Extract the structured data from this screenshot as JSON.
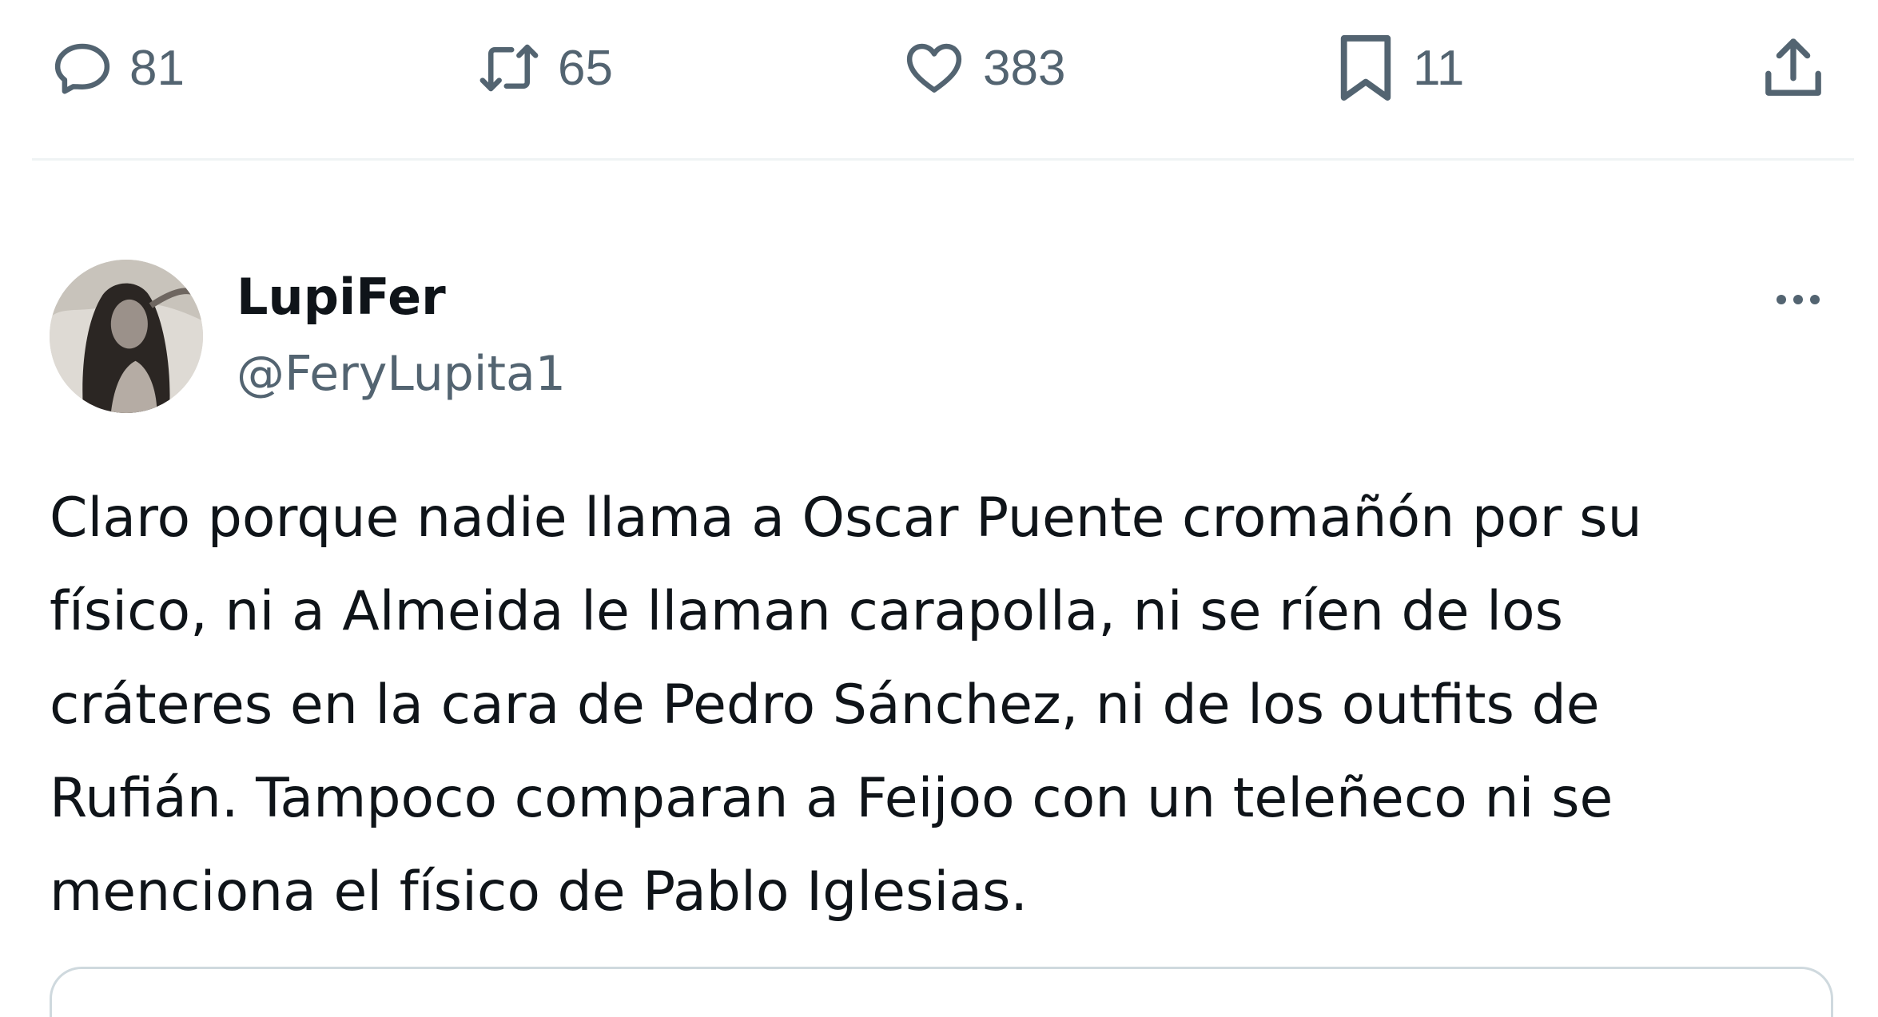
{
  "actions": {
    "reply": {
      "icon": "reply-icon",
      "count": "81"
    },
    "retweet": {
      "icon": "retweet-icon",
      "count": "65"
    },
    "like": {
      "icon": "heart-icon",
      "count": "383"
    },
    "bookmark": {
      "icon": "bookmark-icon",
      "count": "11"
    },
    "share": {
      "icon": "share-icon"
    }
  },
  "tweet": {
    "author": {
      "display_name": "LupiFer",
      "handle": "@FeryLupita1"
    },
    "text_lines": [
      "Claro porque nadie llama a Oscar Puente cromañón por su",
      "físico, ni a Almeida le llaman carapolla, ni se ríen de los",
      "cráteres en la cara de Pedro Sánchez, ni de los outfits de",
      "Rufián. Tampoco comparan a Feijoo con un teleñeco ni se",
      "menciona el físico de Pablo Iglesias."
    ]
  },
  "colors": {
    "text_primary": "#0f1419",
    "text_secondary": "#536471",
    "divider": "#eff3f4",
    "card_border": "#cfd9de"
  }
}
